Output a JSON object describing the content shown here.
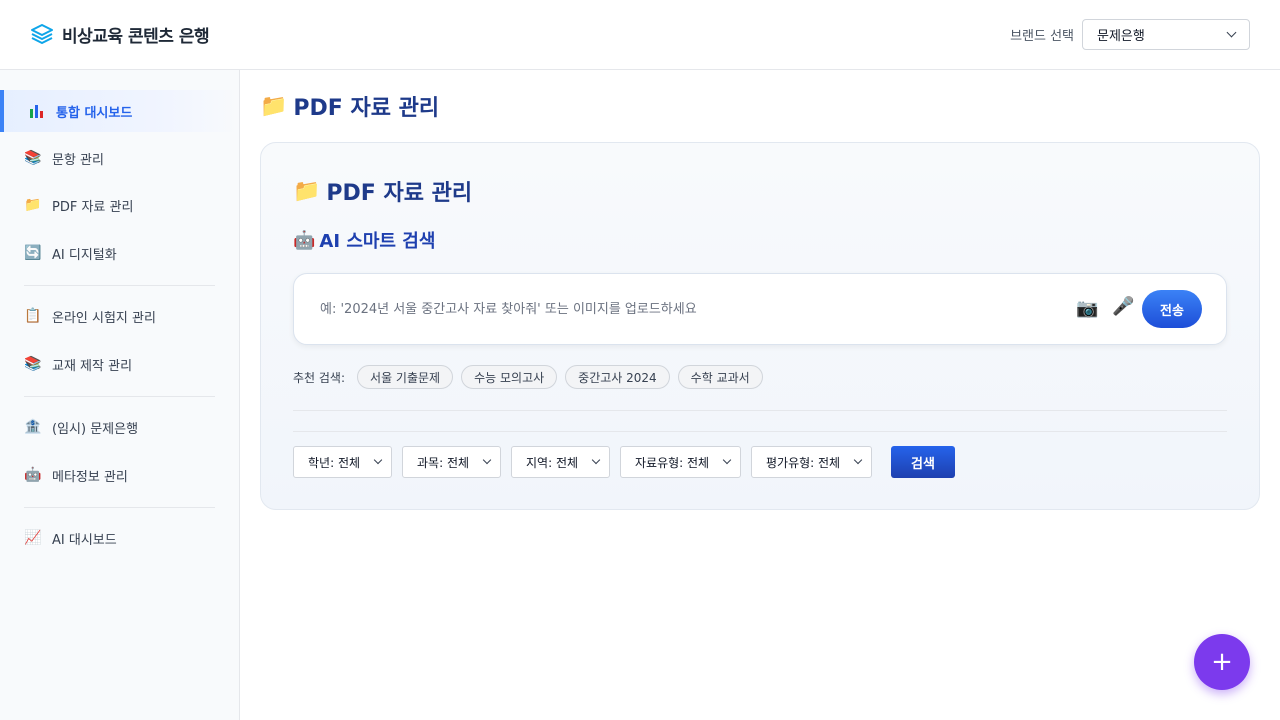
{
  "header": {
    "title": "비상교육 콘텐츠 은행",
    "brand_label": "브랜드 선택",
    "brand_value": "문제은행"
  },
  "sidebar": {
    "items": [
      {
        "label": "통합 대시보드",
        "icon": "chart-bar-icon",
        "active": true
      },
      {
        "label": "문항 관리",
        "icon": "books-icon"
      },
      {
        "label": "PDF 자료 관리",
        "icon": "folder-icon"
      },
      {
        "label": "AI 디지털화",
        "icon": "refresh-icon"
      },
      {
        "label": "온라인 시험지 관리",
        "icon": "clipboard-icon"
      },
      {
        "label": "교재 제작 관리",
        "icon": "books-icon"
      },
      {
        "label": "(임시) 문제은행",
        "icon": "bank-icon"
      },
      {
        "label": "메타정보 관리",
        "icon": "robot-icon"
      },
      {
        "label": "AI 대시보드",
        "icon": "chart-up-icon"
      }
    ]
  },
  "main": {
    "page_title": "PDF 자료 관리",
    "card_title": "PDF 자료 관리",
    "ai_search_title": "AI 스마트 검색",
    "search_placeholder": "예: '2024년 서울 중간고사 자료 찾아줘' 또는 이미지를 업로드하세요",
    "send_label": "전송",
    "suggest_label": "추천 검색:",
    "suggestions": [
      "서울 기출문제",
      "수능 모의고사",
      "중간고사 2024",
      "수학 교과서"
    ],
    "filters": [
      "학년: 전체",
      "과목: 전체",
      "지역: 전체",
      "자료유형: 전체",
      "평가유형: 전체"
    ],
    "search_button": "검색"
  },
  "fab_label": "+",
  "colors": {
    "accent": "#2563eb",
    "title": "#1e3a8a",
    "fab": "#7c3aed"
  }
}
